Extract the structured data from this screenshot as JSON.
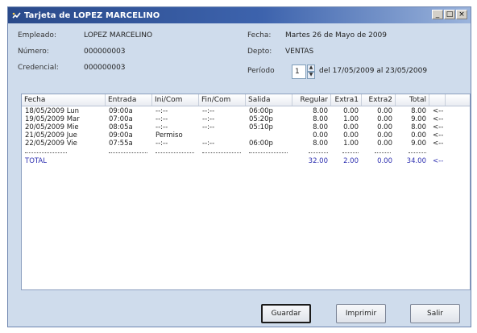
{
  "window": {
    "title": "Tarjeta de LOPEZ MARCELINO",
    "controls": [
      "_",
      "□",
      "×"
    ]
  },
  "info": {
    "empleado_label": "Empleado:",
    "empleado": "LOPEZ MARCELINO",
    "numero_label": "Número:",
    "numero": "000000003",
    "credencial_label": "Credencial:",
    "credencial": "000000003",
    "fecha_label": "Fecha:",
    "fecha": "Martes 26 de Mayo de 2009",
    "depto_label": "Depto:",
    "depto": "VENTAS",
    "periodo_label": "Período",
    "periodo": "1",
    "periodo_rango": "del 17/05/2009 al 23/05/2009"
  },
  "table": {
    "columns": [
      "Fecha",
      "Entrada",
      "Ini/Com",
      "Fin/Com",
      "Salida",
      "Regular",
      "Extra1",
      "Extra2",
      "Total"
    ],
    "rows": [
      [
        "18/05/2009 Lun",
        "09:00a",
        "--:--",
        "--:--",
        "06:00p",
        "8.00",
        "0.00",
        "0.00",
        "8.00",
        "<--"
      ],
      [
        "19/05/2009 Mar",
        "07:00a",
        "--:--",
        "--:--",
        "05:20p",
        "8.00",
        "1.00",
        "0.00",
        "9.00",
        "<--"
      ],
      [
        "20/05/2009 Mie",
        "08:05a",
        "--:--",
        "--:--",
        "05:10p",
        "8.00",
        "0.00",
        "0.00",
        "8.00",
        "<--"
      ],
      [
        "21/05/2009 Jue",
        "09:00a",
        "Permiso",
        "",
        "",
        "0.00",
        "0.00",
        "0.00",
        "0.00",
        "<--"
      ],
      [
        "22/05/2009 Vie",
        "07:55a",
        "--:--",
        "--:--",
        "06:00p",
        "8.00",
        "1.00",
        "0.00",
        "9.00",
        "<--"
      ]
    ],
    "total": {
      "label": "TOTAL",
      "regular": "32.00",
      "extra1": "2.00",
      "extra2": "0.00",
      "total": "34.00",
      "marker": "<--"
    }
  },
  "buttons": {
    "guardar": "Guardar",
    "imprimir": "Imprimir",
    "salir": "Salir"
  }
}
